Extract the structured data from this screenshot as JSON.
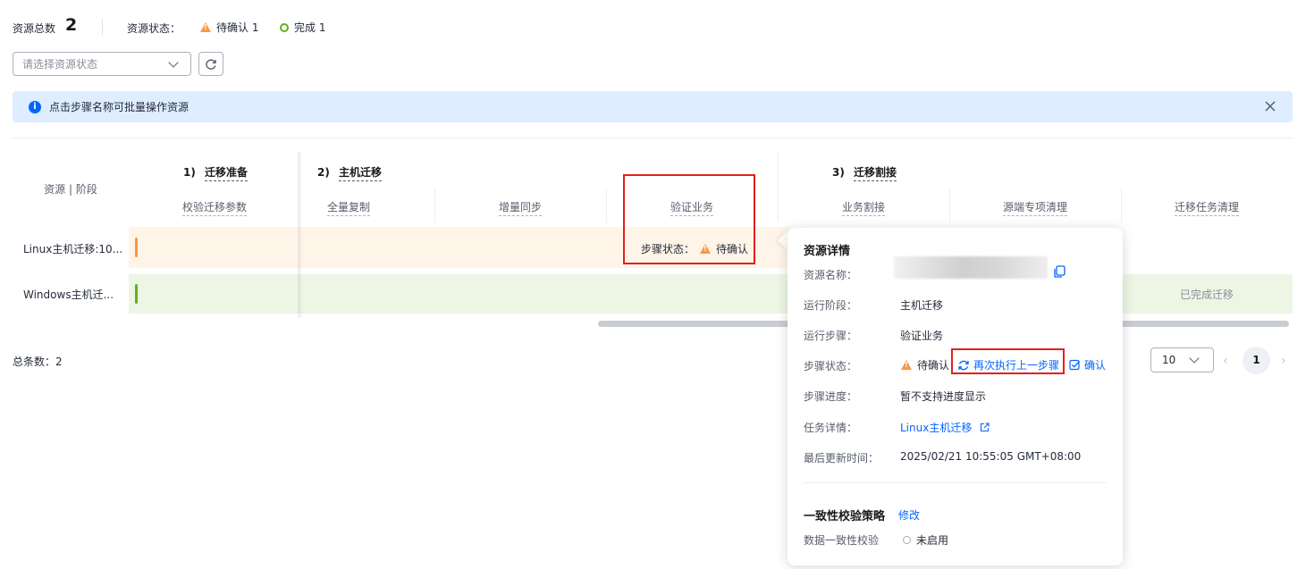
{
  "summary": {
    "total_label": "资源总数",
    "total_count": "2",
    "status_label": "资源状态：",
    "pending_label": "待确认 1",
    "done_label": "完成 1"
  },
  "filter": {
    "placeholder": "请选择资源状态"
  },
  "banner": {
    "text": "点击步骤名称可批量操作资源"
  },
  "table": {
    "corner_header": "资源 | 阶段",
    "phases": [
      {
        "index": "1)",
        "name": "迁移准备"
      },
      {
        "index": "2)",
        "name": "主机迁移"
      },
      {
        "index": "3)",
        "name": "迁移割接"
      }
    ],
    "steps": [
      "校验迁移参数",
      "全量复制",
      "增量同步",
      "验证业务",
      "业务割接",
      "源端专项清理",
      "迁移任务清理"
    ],
    "rows": [
      {
        "name": "Linux主机迁移:10...",
        "status_label": "步骤状态：",
        "status": "待确认"
      },
      {
        "name": "Windows主机迁...",
        "status": "已完成迁移"
      }
    ]
  },
  "pagination": {
    "total": "总条数：2",
    "page_size": "10",
    "current_page": "1"
  },
  "popover": {
    "title": "资源详情",
    "fields": {
      "name_label": "资源名称：",
      "phase_label": "运行阶段：",
      "phase_value": "主机迁移",
      "step_label": "运行步骤：",
      "step_value": "验证业务",
      "status_label": "步骤状态：",
      "status_value": "待确认",
      "rerun_label": "再次执行上一步骤",
      "confirm_label": "确认",
      "progress_label": "步骤进度：",
      "progress_value": "暂不支持进度显示",
      "task_label": "任务详情：",
      "task_link": "Linux主机迁移",
      "updated_label": "最后更新时间：",
      "updated_value": "2025/02/21 10:55:05 GMT+08:00"
    },
    "consistency": {
      "title": "一致性校验策略",
      "edit_label": "修改",
      "check_label": "数据一致性校验",
      "check_value": "未启用"
    }
  },
  "colors": {
    "pending": "#fa9841",
    "done": "#5fb317",
    "link": "#0066ff",
    "highlight": "#e02020"
  }
}
